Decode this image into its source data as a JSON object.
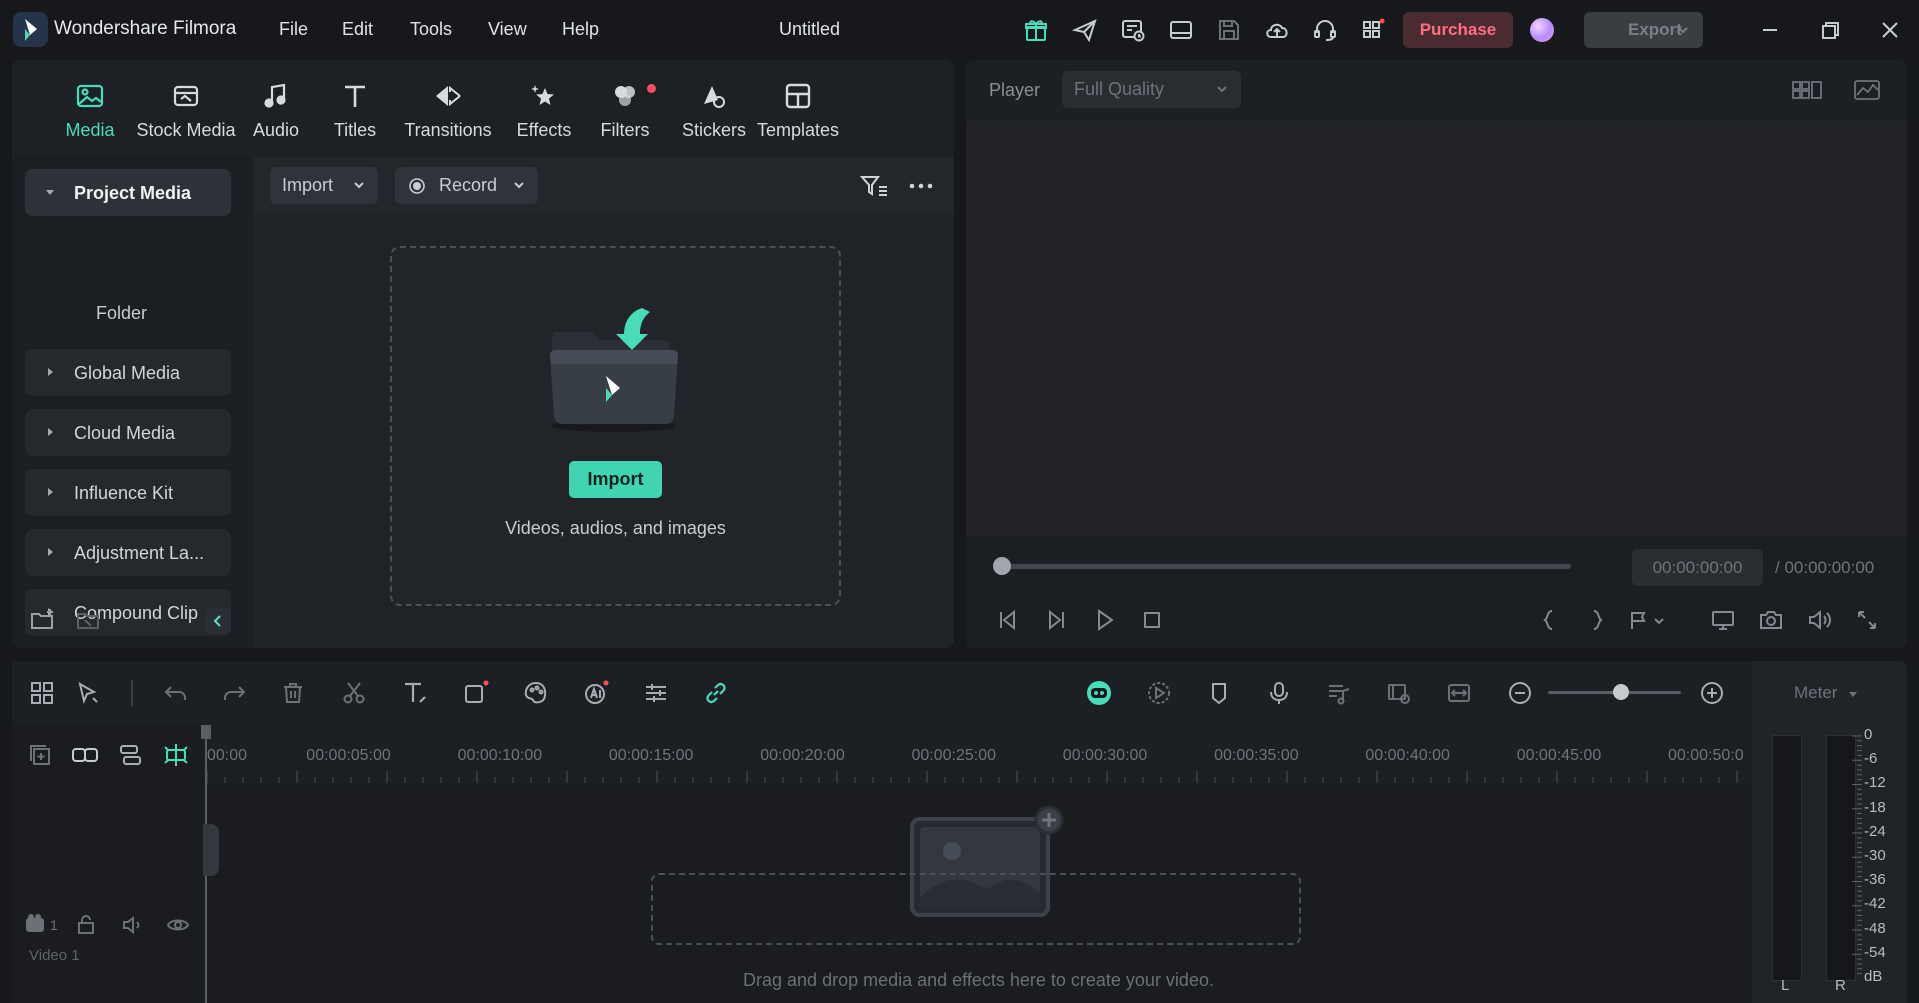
{
  "app": {
    "name": "Wondershare Filmora",
    "document_title": "Untitled"
  },
  "menu": [
    "File",
    "Edit",
    "Tools",
    "View",
    "Help"
  ],
  "titlebar": {
    "purchase_label": "Purchase",
    "export_label": "Export"
  },
  "media_tabs": [
    {
      "label": "Media",
      "icon": "media-icon",
      "active": true
    },
    {
      "label": "Stock Media",
      "icon": "stock-media-icon"
    },
    {
      "label": "Audio",
      "icon": "music-note-icon"
    },
    {
      "label": "Titles",
      "icon": "text-t-icon"
    },
    {
      "label": "Transitions",
      "icon": "transitions-icon"
    },
    {
      "label": "Effects",
      "icon": "effects-star-icon"
    },
    {
      "label": "Filters",
      "icon": "filters-icon",
      "badge_dot": true
    },
    {
      "label": "Stickers",
      "icon": "stickers-icon"
    },
    {
      "label": "Templates",
      "icon": "templates-icon"
    }
  ],
  "sidebar": {
    "project_media": "Project Media",
    "folder": "Folder",
    "items": [
      "Global Media",
      "Cloud Media",
      "Influence Kit",
      "Adjustment La...",
      "Compound Clip"
    ]
  },
  "media_toolbar": {
    "import_label": "Import",
    "record_label": "Record"
  },
  "drop_zone": {
    "button_label": "Import",
    "hint": "Videos, audios, and images"
  },
  "player": {
    "label": "Player",
    "quality": "Full Quality",
    "current_time": "00:00:00:00",
    "total_time": "/ 00:00:00:00",
    "progress": 0
  },
  "timeline": {
    "ruler_labels": [
      "00:00",
      "00:00:05:00",
      "00:00:10:00",
      "00:00:15:00",
      "00:00:20:00",
      "00:00:25:00",
      "00:00:30:00",
      "00:00:35:00",
      "00:00:40:00",
      "00:00:45:00",
      "00:00:50:0"
    ],
    "track_name": "Video 1",
    "track_number": "1",
    "drop_hint": "Drag and drop media and effects here to create your video.",
    "zoom_level": 0.55
  },
  "meter": {
    "label": "Meter",
    "db_labels": [
      "0",
      "-6",
      "-12",
      "-18",
      "-24",
      "-30",
      "-36",
      "-42",
      "-48",
      "-54",
      "dB"
    ],
    "channels": [
      "L",
      "R"
    ]
  },
  "colors": {
    "accent": "#49dcb9",
    "purchase": "#ff6c84",
    "notification": "#ff4d5e"
  }
}
